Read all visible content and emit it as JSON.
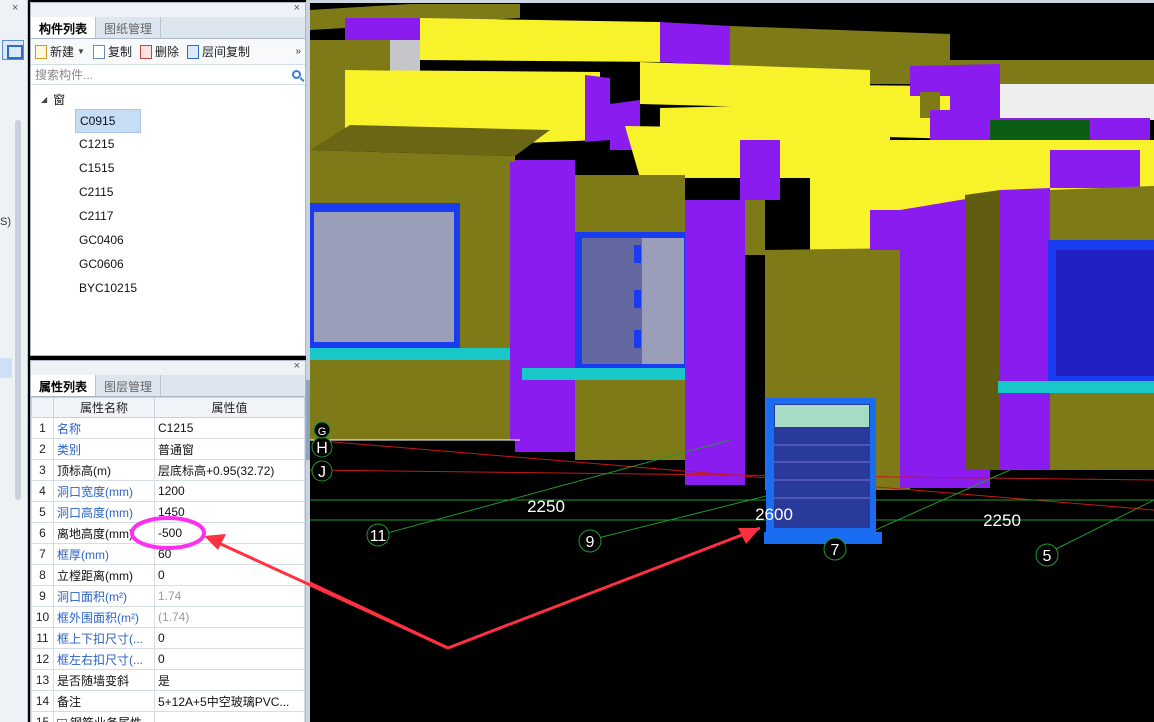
{
  "component_panel": {
    "tabs": [
      {
        "label": "构件列表",
        "active": true
      },
      {
        "label": "图纸管理",
        "active": false
      }
    ],
    "toolbar": {
      "new_label": "新建",
      "copy_label": "复制",
      "delete_label": "删除",
      "floor_copy_label": "层间复制",
      "more_label": "»"
    },
    "search_placeholder": "搜索构件...",
    "tree": {
      "root_label": "窗",
      "items": [
        "C0915",
        "C1215",
        "C1515",
        "C2115",
        "C2117",
        "GC0406",
        "GC0606",
        "BYC10215"
      ],
      "selected": "C0915"
    }
  },
  "property_panel": {
    "tabs": [
      {
        "label": "属性列表",
        "active": true
      },
      {
        "label": "图层管理",
        "active": false
      }
    ],
    "columns": [
      "属性名称",
      "属性值"
    ],
    "rows": [
      {
        "idx": "1",
        "name": "名称",
        "value": "C1215",
        "blue": true
      },
      {
        "idx": "2",
        "name": "类别",
        "value": "普通窗",
        "blue": true
      },
      {
        "idx": "3",
        "name": "顶标高(m)",
        "value": "层底标高+0.95(32.72)",
        "blue": false
      },
      {
        "idx": "4",
        "name": "洞口宽度(mm)",
        "value": "1200",
        "blue": true
      },
      {
        "idx": "5",
        "name": "洞口高度(mm)",
        "value": "1450",
        "blue": true
      },
      {
        "idx": "6",
        "name": "离地高度(mm)",
        "value": "-500",
        "blue": false
      },
      {
        "idx": "7",
        "name": "框厚(mm)",
        "value": "60",
        "blue": true
      },
      {
        "idx": "8",
        "name": "立樘距离(mm)",
        "value": "0",
        "blue": false
      },
      {
        "idx": "9",
        "name": "洞口面积(m²)",
        "value": "1.74",
        "blue": true,
        "gray": true
      },
      {
        "idx": "10",
        "name": "框外围面积(m²)",
        "value": "(1.74)",
        "blue": true,
        "gray": true
      },
      {
        "idx": "11",
        "name": "框上下扣尺寸(...",
        "value": "0",
        "blue": true
      },
      {
        "idx": "12",
        "name": "框左右扣尺寸(...",
        "value": "0",
        "blue": true
      },
      {
        "idx": "13",
        "name": "是否随墙变斜",
        "value": "是",
        "blue": false
      },
      {
        "idx": "14",
        "name": "备注",
        "value": "5+12A+5中空玻璃PVC...",
        "blue": false
      },
      {
        "idx": "15",
        "name": "钢筋业务属性",
        "value": "",
        "blue": false,
        "expander": true
      }
    ]
  },
  "viewport": {
    "dimension_labels": [
      "2250",
      "2600",
      "2250"
    ],
    "axis_labels": [
      "11",
      "9",
      "7",
      "5",
      "H",
      "J",
      "G"
    ],
    "colors": {
      "wall_olive": "#7f7a18",
      "wall_olive_dark": "#605c10",
      "column_purple": "#8a1cf0",
      "slab_yellow": "#f8f22a",
      "window_blue": "#1a3cf0",
      "window_glass": "#9b9eb8",
      "sill_cyan": "#18c7c7",
      "highlight": "#ff2ff0",
      "arrow_red": "#ff3040",
      "grid_green": "#1f9a2c",
      "grid_red": "#c41818"
    }
  },
  "left_strip": {
    "partial_text": "S)"
  }
}
